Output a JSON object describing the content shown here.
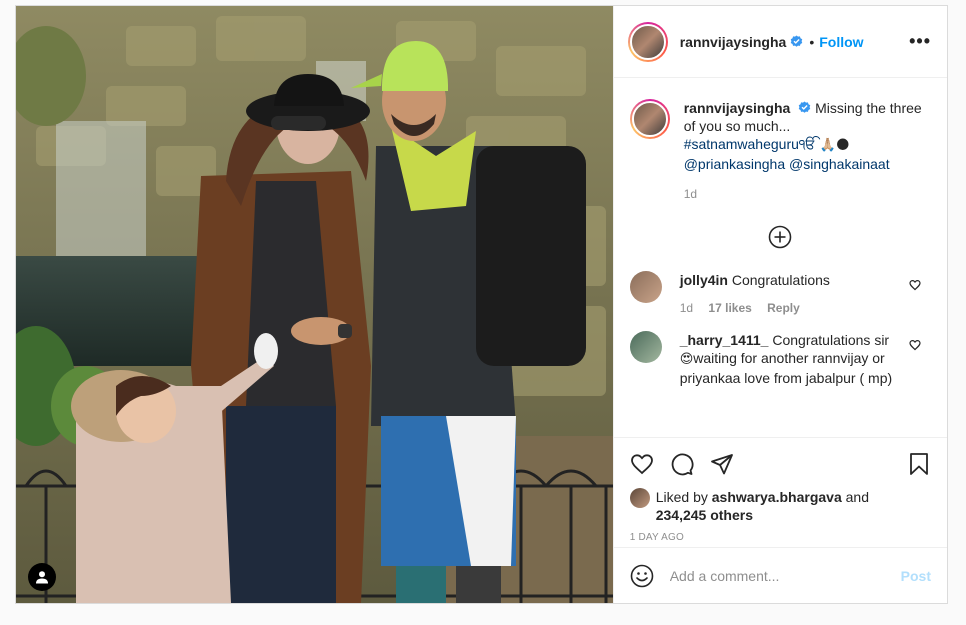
{
  "header": {
    "username": "rannvijaysingha",
    "follow_label": "Follow",
    "more_label": "•••",
    "separator": "•"
  },
  "caption": {
    "username": "rannvijaysingha",
    "text": "Missing the three of you so much...",
    "hashtag": "#satnamwaheguruੴ",
    "emojis": "🙏🏼🌑",
    "mention_1": "@priankasingha",
    "mention_2": "@singhakainaat",
    "time": "1d"
  },
  "comments": [
    {
      "username": "jolly4in",
      "text": "Congratulations",
      "time": "1d",
      "likes": "17 likes",
      "reply_label": "Reply",
      "avatar_color": "#8a6d5a"
    },
    {
      "username": "_harry_1411_",
      "text_1": "Congratulations sir",
      "emoji": "😍",
      "text_2": "waiting for another rannvijay or priyankaa love from jabalpur ( mp)",
      "avatar_color": "#4a6a5a"
    }
  ],
  "likes": {
    "prefix": "Liked by",
    "liker": "ashwarya.bhargava",
    "middle": "and",
    "others": "234,245 others"
  },
  "date": "1 DAY AGO",
  "add_comment": {
    "placeholder": "Add a comment...",
    "post_label": "Post"
  },
  "icons": {
    "more_comments": "plus-circle-icon",
    "like": "heart-icon",
    "comment": "comment-icon",
    "share": "share-icon",
    "save": "bookmark-icon",
    "emoji": "smiley-icon",
    "tagged_users": "user-tag-icon",
    "verified": "verified-badge-icon"
  },
  "colors": {
    "accent": "#0095f6",
    "post_disabled": "#b2dffc",
    "muted": "#8e8e8e",
    "link": "#00376b"
  }
}
